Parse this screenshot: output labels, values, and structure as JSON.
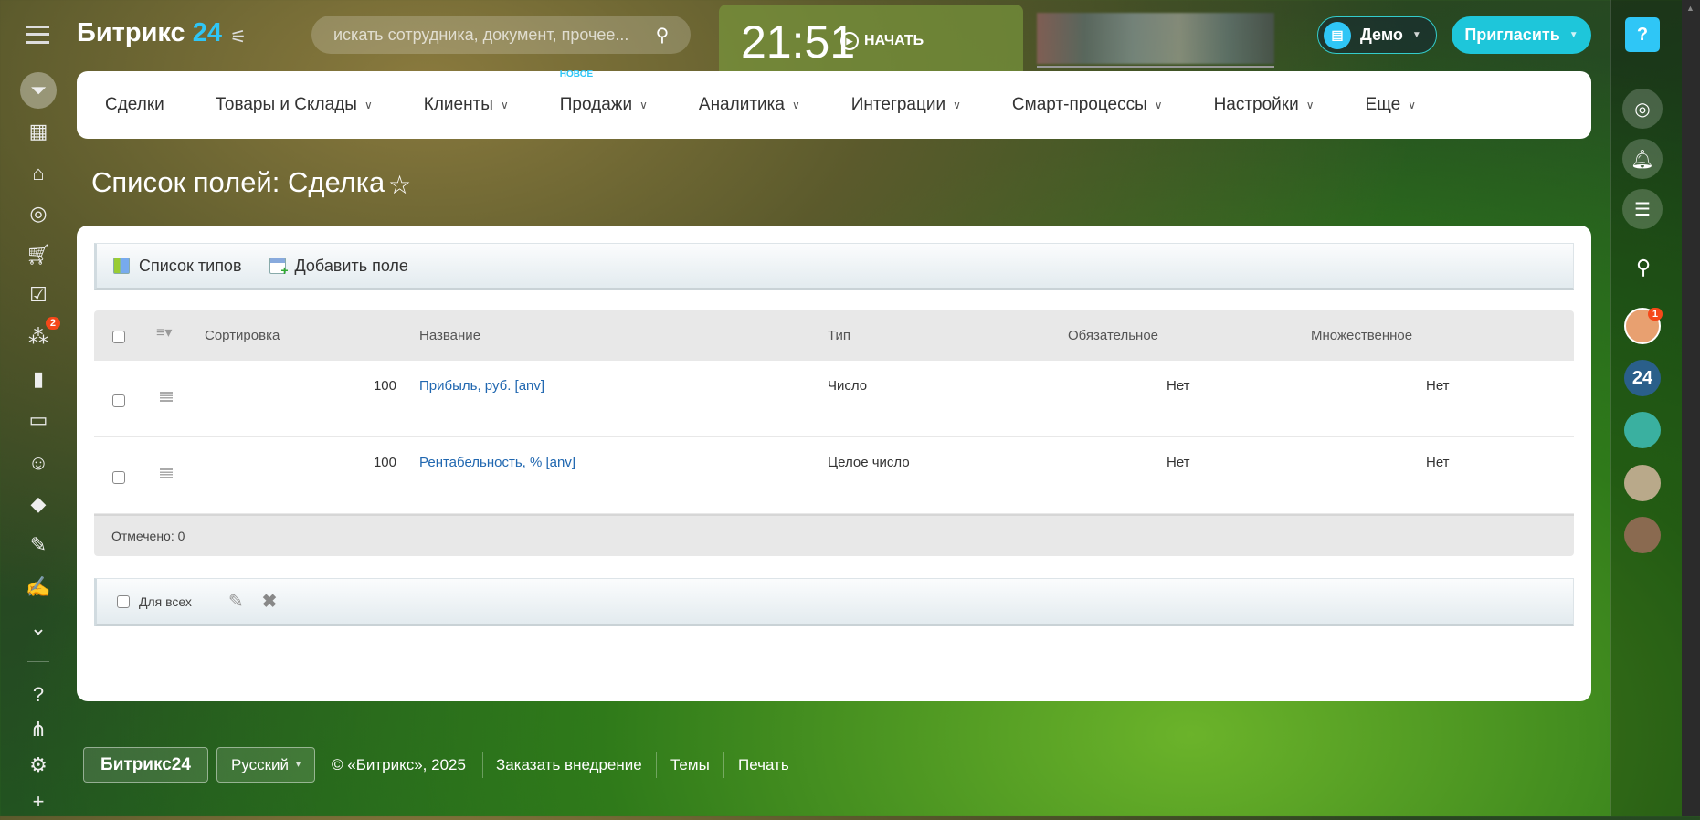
{
  "header": {
    "logo_main": "Битрикс",
    "logo_num": "24",
    "search_placeholder": "искать сотрудника, документ, прочее...",
    "clock": "21:51",
    "start_label": "НАЧАТЬ",
    "demo_label": "Демо",
    "invite_label": "Пригласить",
    "help": "?"
  },
  "menu": {
    "items": [
      {
        "label": "Сделки"
      },
      {
        "label": "Товары и Склады"
      },
      {
        "label": "Клиенты"
      },
      {
        "label": "Продажи",
        "badge": "НОВОЕ"
      },
      {
        "label": "Аналитика"
      },
      {
        "label": "Интеграции"
      },
      {
        "label": "Смарт-процессы"
      },
      {
        "label": "Настройки"
      },
      {
        "label": "Еще"
      }
    ]
  },
  "sidebar": {
    "tasks_badge": "2"
  },
  "right_panel": {
    "notif_badge": "1",
    "bitrix_avatar": "24"
  },
  "page": {
    "title": "Список полей: Сделка"
  },
  "toolbar": {
    "types_list": "Список типов",
    "add_field": "Добавить поле"
  },
  "grid": {
    "columns": [
      "Сортировка",
      "Название",
      "Тип",
      "Обязательное",
      "Множественное"
    ],
    "rows": [
      {
        "sort": "100",
        "name": "Прибыль, руб. [anv]",
        "type": "Число",
        "required": "Нет",
        "multiple": "Нет"
      },
      {
        "sort": "100",
        "name": "Рентабельность, % [anv]",
        "type": "Целое число",
        "required": "Нет",
        "multiple": "Нет"
      }
    ],
    "selected": "Отмечено: 0",
    "for_all": "Для всех"
  },
  "footer": {
    "logo": "Битрикс24",
    "language": "Русский",
    "copyright": "© «Битрикс», 2025",
    "order": "Заказать внедрение",
    "themes": "Темы",
    "print": "Печать"
  },
  "colors": {
    "accent": "#2fc6f6",
    "invite": "#1ec6da",
    "link": "#2067b0",
    "badge": "#f54819"
  }
}
